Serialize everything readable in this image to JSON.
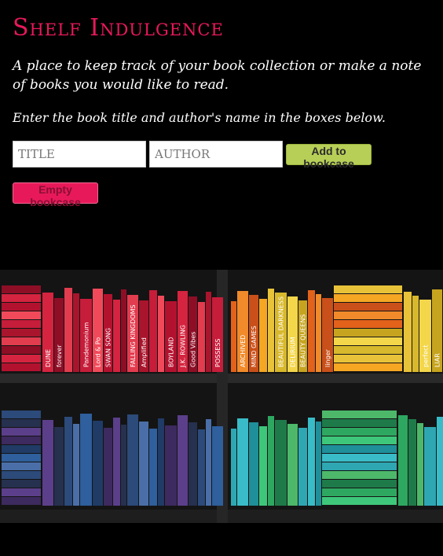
{
  "app": {
    "title": "Shelf Indulgence",
    "intro": "A place to keep track of your book collection or make a note of books you would like to read.",
    "instructions": "Enter the book title and author's name in the boxes below."
  },
  "form": {
    "title_placeholder": "TITLE",
    "author_placeholder": "AUTHOR",
    "title_value": "",
    "author_value": "",
    "add_label": "Add to bookcase",
    "empty_label": "Empty bookcase"
  },
  "colors": {
    "accent": "#e8195a",
    "add_button": "#b7cf57",
    "background": "#000000"
  },
  "bookcase": {
    "spine_labels": [
      "DUNE",
      "forever",
      "Pandemonium",
      "Lord & Po",
      "SWAN SONG",
      "FALLING KINGDOMS",
      "Amplified",
      "BOYLAND",
      "J.K. ROWLING",
      "Good Vibes",
      "POSSESS",
      "ARCHIVED",
      "MIND GAMES",
      "BEAUTIFUL DARKNESS",
      "DELIRIUM",
      "BEAUTY QUEENS",
      "linger",
      "perfect",
      "LIAR"
    ]
  }
}
